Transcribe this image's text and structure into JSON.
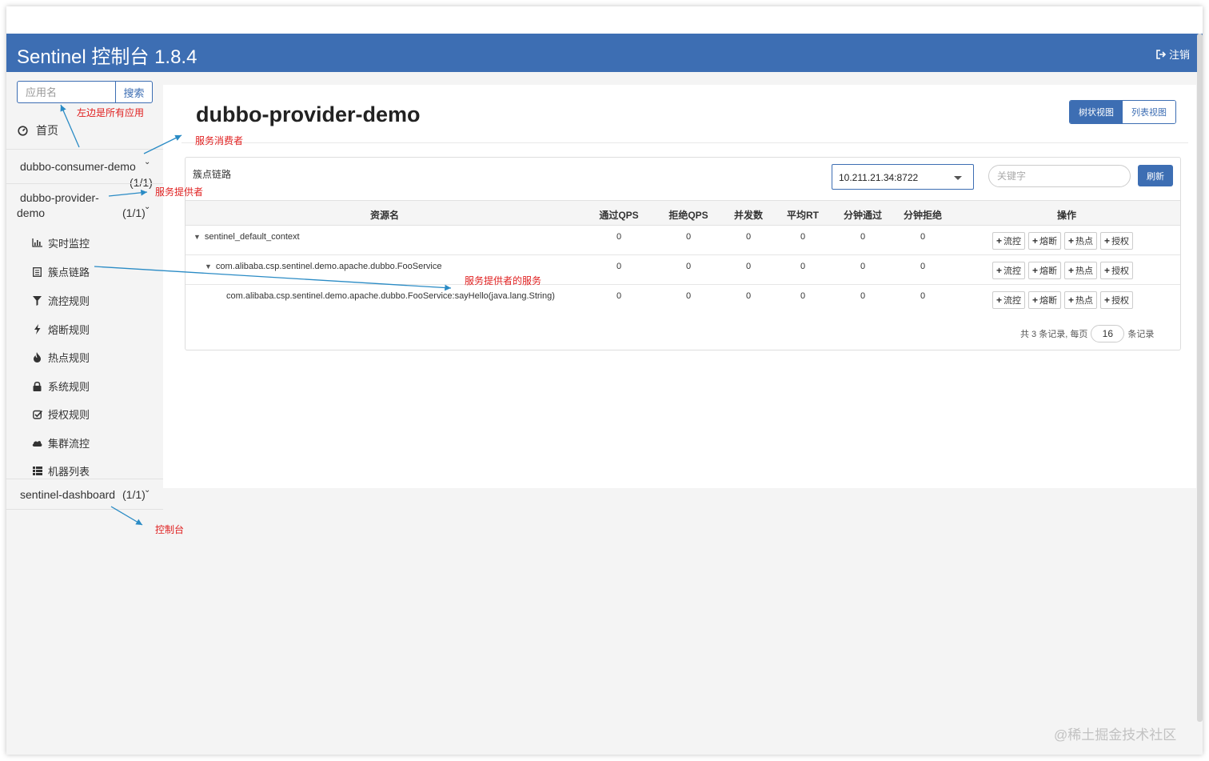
{
  "header": {
    "title": "Sentinel 控制台 1.8.4",
    "logout_label": "注销"
  },
  "sidebar": {
    "search_placeholder": "应用名",
    "search_button": "搜索",
    "home_label": "首页",
    "apps": [
      {
        "name": "dubbo-consumer-demo",
        "count": "(1/1)"
      },
      {
        "name_line1": "dubbo-provider-",
        "name_line2": "demo",
        "count": "(1/1)"
      },
      {
        "name": "sentinel-dashboard",
        "count": "(1/1)"
      }
    ],
    "menu": [
      {
        "label": "实时监控",
        "icon": "bar-chart-icon"
      },
      {
        "label": "簇点链路",
        "icon": "list-icon"
      },
      {
        "label": "流控规则",
        "icon": "filter-icon"
      },
      {
        "label": "熔断规则",
        "icon": "flash-icon"
      },
      {
        "label": "热点规则",
        "icon": "fire-icon"
      },
      {
        "label": "系统规则",
        "icon": "lock-icon"
      },
      {
        "label": "授权规则",
        "icon": "check-icon"
      },
      {
        "label": "集群流控",
        "icon": "cloud-icon"
      },
      {
        "label": "机器列表",
        "icon": "th-list-icon"
      }
    ]
  },
  "main": {
    "title": "dubbo-provider-demo",
    "view_tree": "树状视图",
    "view_list": "列表视图",
    "panel_title": "簇点链路",
    "machine": "10.211.21.34:8722",
    "keyword_placeholder": "关键字",
    "refresh": "刷新",
    "columns": [
      "资源名",
      "通过QPS",
      "拒绝QPS",
      "并发数",
      "平均RT",
      "分钟通过",
      "分钟拒绝",
      "操作"
    ],
    "rows": [
      {
        "resource": "sentinel_default_context",
        "values": [
          "0",
          "0",
          "0",
          "0",
          "0",
          "0"
        ]
      },
      {
        "resource": "com.alibaba.csp.sentinel.demo.apache.dubbo.FooService",
        "values": [
          "0",
          "0",
          "0",
          "0",
          "0",
          "0"
        ]
      },
      {
        "resource": "com.alibaba.csp.sentinel.demo.apache.dubbo.FooService:sayHello(java.lang.String)",
        "values": [
          "0",
          "0",
          "0",
          "0",
          "0",
          "0"
        ]
      }
    ],
    "ops": [
      "流控",
      "熔断",
      "热点",
      "授权"
    ],
    "pager": {
      "prefix": "共 3 条记录, 每页",
      "page_size": "16",
      "suffix": "条记录"
    }
  },
  "annotations": {
    "all_apps": "左边是所有应用",
    "consumer": "服务消费者",
    "provider": "服务提供者",
    "provider_service": "服务提供者的服务",
    "dashboard": "控制台"
  },
  "watermark": "@稀土掘金技术社区",
  "colors": {
    "primary": "#3d6eb3",
    "annotation": "#e02020",
    "arrow": "#2a8bc5"
  }
}
